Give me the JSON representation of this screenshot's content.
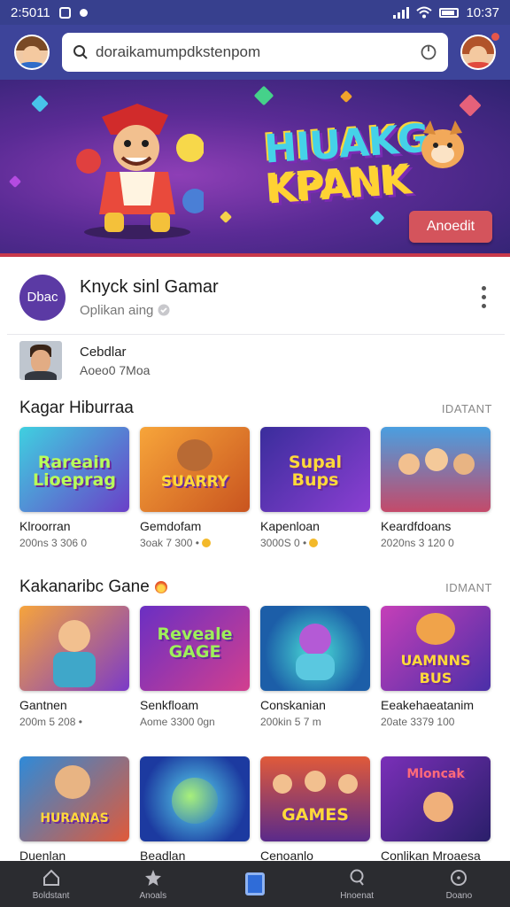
{
  "status_bar": {
    "time_left": "2:5011",
    "time_right": "10:37"
  },
  "header": {
    "search_text": "doraikamumpdkstenpom"
  },
  "banner": {
    "title_line1": "HIUAKG",
    "title_line2": "KPANK",
    "button_label": "Anoedit",
    "colors": {
      "accent_border": "#c9394a",
      "button": "#d4545c"
    }
  },
  "info_card": {
    "logo_text": "Dbac",
    "title": "Knyck sinl Gamar",
    "subtitle": "Oplikan aing",
    "logo_color": "#5b3aa4"
  },
  "developer": {
    "name": "Cebdlar",
    "sub": "Aoeo0 7Moa"
  },
  "sections": [
    {
      "title": "Kagar Hiburraa",
      "link": "IDATANT",
      "tiles": [
        {
          "thumb_text": "Rareain Lioeprag",
          "name": "Klroorran",
          "meta": "200ns 3 306 0",
          "theme": "cyan"
        },
        {
          "thumb_text": "SUARRY",
          "name": "Gemdofam",
          "meta": "3oak 7 300 •",
          "theme": "orange"
        },
        {
          "thumb_text": "Supal Bups",
          "name": "Kapenloan",
          "meta": "3000S 0 •",
          "theme": "purple"
        },
        {
          "thumb_text": "",
          "name": "Keardfdoans",
          "meta": "2020ns 3 120 0",
          "theme": "teal"
        }
      ]
    },
    {
      "title": "Kakanaribc Gane",
      "link": "IDMANT",
      "tiles": [
        {
          "thumb_text": "",
          "name": "Gantnen",
          "meta": "200m 5 208 •",
          "theme": "sunset"
        },
        {
          "thumb_text": "Reveale GAGE",
          "name": "Senkfloam",
          "meta": "Aome 3300 0gn",
          "theme": "violet"
        },
        {
          "thumb_text": "",
          "name": "Conskanian",
          "meta": "200kin 5 7 m",
          "theme": "aqua"
        },
        {
          "thumb_text": "UAMNNS BUS",
          "name": "Eeakehaeatanim",
          "meta": "20ate 3379 100",
          "theme": "pink"
        }
      ]
    },
    {
      "title": "",
      "link": "",
      "tiles": [
        {
          "thumb_text": "HURANAS",
          "name": "Duenlan",
          "meta": "",
          "theme": "cyan"
        },
        {
          "thumb_text": "",
          "name": "Beadlan",
          "meta": "",
          "theme": "blue"
        },
        {
          "thumb_text": "GAMES",
          "name": "Cenoanlo",
          "meta": "",
          "theme": "crowd"
        },
        {
          "thumb_text": "Mloncak",
          "name": "Conlikan Mroaesa",
          "meta": "",
          "theme": "magenta"
        }
      ]
    }
  ],
  "bottom_nav": [
    {
      "label": "Boldstant",
      "icon": "home-icon"
    },
    {
      "label": "Anoals",
      "icon": "star-icon"
    },
    {
      "label": "",
      "icon": "square-icon"
    },
    {
      "label": "Hnoenat",
      "icon": "pin-icon"
    },
    {
      "label": "Doano",
      "icon": "clock-icon"
    }
  ]
}
